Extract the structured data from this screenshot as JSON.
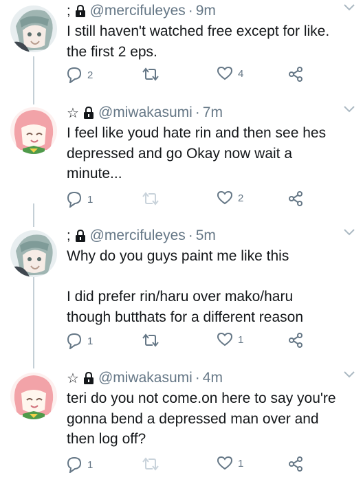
{
  "tweets": [
    {
      "prefix": ";",
      "handle": "@mercifuleyes",
      "dot": "·",
      "time": "9m",
      "text": "I still haven't watched free except for like.\nthe first 2 eps.",
      "replies": "2",
      "retweets": "",
      "likes": "4"
    },
    {
      "prefix": "☆",
      "handle": "@miwakasumi",
      "dot": "·",
      "time": "7m",
      "text": "I feel like youd hate rin and then see hes\ndepressed and go Okay now wait a\nminute...",
      "replies": "1",
      "retweets": "",
      "likes": "2"
    },
    {
      "prefix": ";",
      "handle": "@mercifuleyes",
      "dot": "·",
      "time": "5m",
      "text": "Why do you guys paint me like this\n\nI did prefer rin/haru over mako/haru\nthough butthats for a different reason",
      "replies": "1",
      "retweets": "",
      "likes": "1"
    },
    {
      "prefix": "☆",
      "handle": "@miwakasumi",
      "dot": "·",
      "time": "4m",
      "text": "teri do you not come.on here to say you're\ngonna bend a depressed man over and\nthen log off?",
      "replies": "1",
      "retweets": "",
      "likes": "1"
    }
  ],
  "icons": {
    "reply": "reply-icon",
    "retweet": "retweet-icon",
    "like": "like-icon",
    "share": "share-icon",
    "lock": "lock-icon",
    "chevron": "chevron-down-icon"
  },
  "colors": {
    "text": "#14171a",
    "secondary": "#657786",
    "thread_line": "#c4cfd6",
    "retweet_disabled": "#c9d3db"
  }
}
